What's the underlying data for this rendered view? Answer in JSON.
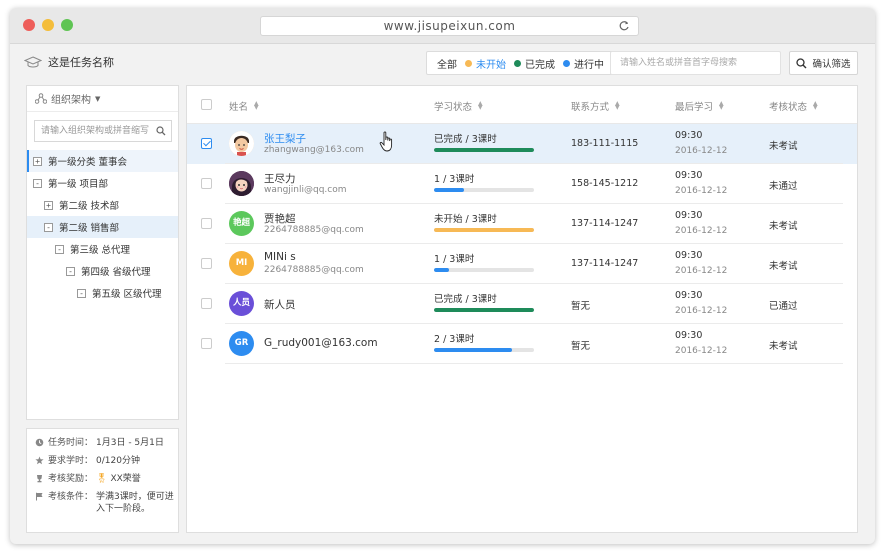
{
  "browser": {
    "url": "www.jisupeixun.com"
  },
  "task": {
    "title": "这是任务名称"
  },
  "filters": [
    {
      "label": "全部",
      "color": "",
      "active": false
    },
    {
      "label": "未开始",
      "color": "#f7b955",
      "active": true
    },
    {
      "label": "已完成",
      "color": "#1e8b5a",
      "active": false
    },
    {
      "label": "进行中",
      "color": "#2d8cf0",
      "active": false
    }
  ],
  "search": {
    "placeholder": "请输入姓名或拼音首字母搜索"
  },
  "confirm_label": "确认筛选",
  "org": {
    "title": "组织架构",
    "search_placeholder": "请输入组织架构或拼音缩写",
    "nodes": [
      {
        "toggle": "+",
        "label": "第一级分类 董事会",
        "level": 0,
        "state": "first"
      },
      {
        "toggle": "-",
        "label": "第一级 项目部",
        "level": 0,
        "state": ""
      },
      {
        "toggle": "+",
        "label": "第二级 技术部",
        "level": 1,
        "state": ""
      },
      {
        "toggle": "-",
        "label": "第二级 销售部",
        "level": 1,
        "state": "sel"
      },
      {
        "toggle": "-",
        "label": "第三级 总代理",
        "level": 2,
        "state": ""
      },
      {
        "toggle": "-",
        "label": "第四级 省级代理",
        "level": 3,
        "state": ""
      },
      {
        "toggle": "-",
        "label": "第五级 区级代理",
        "level": 4,
        "state": ""
      }
    ]
  },
  "info": [
    {
      "icon": "clock-icon",
      "label": "任务时间：",
      "value": "1月3日 - 5月1日"
    },
    {
      "icon": "star-icon",
      "label": "要求学时：",
      "value": "0/120分钟"
    },
    {
      "icon": "trophy-icon",
      "label": "考核奖励：",
      "value": "XX荣誉"
    },
    {
      "icon": "flag-icon",
      "label": "考核条件：",
      "value": "学满3课时，便可进入下一阶段。"
    }
  ],
  "table": {
    "headers": [
      "姓名",
      "学习状态",
      "联系方式",
      "最后学习",
      "考核状态"
    ],
    "rows": [
      {
        "name": "张王梨子",
        "email": "zhangwang@163.com",
        "avatar": "",
        "avatar_color": "#f0c9a0",
        "avatar_type": "cartoon1",
        "status": "已完成 / 3课时",
        "progress": 1.0,
        "bar_color": "#1e8b5a",
        "phone": "183-111-1115",
        "time": "09:30",
        "date": "2016-12-12",
        "exam": "未考试",
        "highlight": true,
        "checked": true
      },
      {
        "name": "王尽力",
        "email": "wangjinli@qq.com",
        "avatar": "",
        "avatar_color": "#5b3a5e",
        "avatar_type": "cartoon2",
        "status": "1 / 3课时",
        "progress": 0.3,
        "bar_color": "#2d8cf0",
        "phone": "158-145-1212",
        "time": "09:30",
        "date": "2016-12-12",
        "exam": "未通过",
        "highlight": false,
        "checked": false
      },
      {
        "name": "贾艳超",
        "email": "2264788885@qq.com",
        "avatar": "艳超",
        "avatar_color": "#5cc85c",
        "avatar_type": "text",
        "status": "未开始 / 3课时",
        "progress": 1.0,
        "bar_color": "#f7b955",
        "phone": "137-114-1247",
        "time": "09:30",
        "date": "2016-12-12",
        "exam": "未考试",
        "highlight": false,
        "checked": false
      },
      {
        "name": "MINi s",
        "email": "2264788885@qq.com",
        "avatar": "MI",
        "avatar_color": "#f7b23b",
        "avatar_type": "text",
        "status": "1 / 3课时",
        "progress": 0.15,
        "bar_color": "#2d8cf0",
        "phone": "137-114-1247",
        "time": "09:30",
        "date": "2016-12-12",
        "exam": "未考试",
        "highlight": false,
        "checked": false
      },
      {
        "name": "新人员",
        "email": "",
        "avatar": "人员",
        "avatar_color": "#6a4fd8",
        "avatar_type": "text",
        "status": "已完成 / 3课时",
        "progress": 1.0,
        "bar_color": "#1e8b5a",
        "phone": "暂无",
        "time": "09:30",
        "date": "2016-12-12",
        "exam": "已通过",
        "highlight": false,
        "checked": false
      },
      {
        "name": "G_rudy001@163.com",
        "email": "",
        "avatar": "GR",
        "avatar_color": "#2d8cf0",
        "avatar_type": "text",
        "status": "2 / 3课时",
        "progress": 0.78,
        "bar_color": "#2d8cf0",
        "phone": "暂无",
        "time": "09:30",
        "date": "2016-12-12",
        "exam": "未考试",
        "highlight": false,
        "checked": false
      }
    ]
  }
}
